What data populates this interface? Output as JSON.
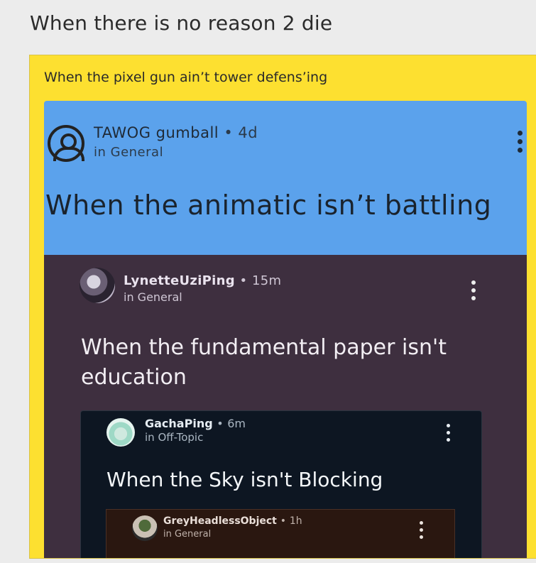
{
  "post": {
    "title": "When there is no reason 2 die",
    "caption": "When the pixel gun ain’t tower defens’ing"
  },
  "nested_posts": [
    {
      "username": "TAWOG gumball",
      "separator": "•",
      "time": "4d",
      "location": "in General",
      "body": "When the animatic isn’t battling",
      "bg_color": "#5ba2ec"
    },
    {
      "username": "LynetteUziPing",
      "separator": "•",
      "time": "15m",
      "location": "in General",
      "body": "When the fundamental paper isn't education",
      "bg_color": "#3e2f3f"
    },
    {
      "username": "GachaPing",
      "separator": "•",
      "time": "6m",
      "location": "in Off-Topic",
      "body": "When the Sky isn't Blocking",
      "bg_color": "#0d1622"
    },
    {
      "username": "GreyHeadlessObject",
      "separator": "•",
      "time": "1h",
      "location": "in General",
      "body": "",
      "bg_color": "#2a1710"
    }
  ],
  "colors": {
    "frame": "#fde030",
    "page_bg": "#ececec"
  },
  "icons": {
    "default_avatar": "user-circle-icon",
    "menu": "vertical-ellipsis-icon"
  }
}
